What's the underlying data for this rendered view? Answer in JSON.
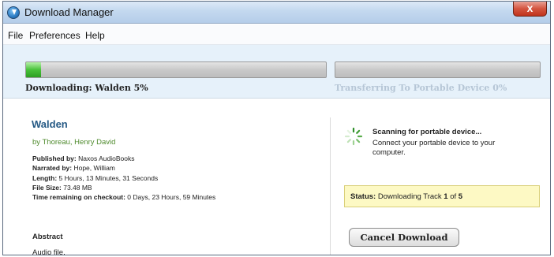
{
  "window": {
    "title": "Download Manager",
    "close_glyph": "x"
  },
  "menu": [
    "File",
    "Preferences",
    "Help"
  ],
  "progress": {
    "download_label": "Downloading: Walden  5%",
    "download_fraction": 0.05,
    "transfer_label": "Transferring To Portable Device 0%",
    "transfer_fraction": 0.0,
    "fill_color": "#49c23a"
  },
  "book": {
    "title": "Walden",
    "author": "by Thoreau, Henry David",
    "published_by_label": "Published by:",
    "published_by": "Naxos AudioBooks",
    "narrated_by_label": "Narrated by:",
    "narrated_by": "Hope, William",
    "length_label": "Length:",
    "length": "5 Hours, 13 Minutes, 31 Seconds",
    "file_size_label": "File Size:",
    "file_size": "73.48 MB",
    "time_remaining_label": "Time remaining on checkout:",
    "time_remaining": "0 Days, 23 Hours, 59 Minutes",
    "abstract_title": "Abstract",
    "abstract_text": "Audio file."
  },
  "device": {
    "scan_title": "Scanning for portable device...",
    "scan_body": "Connect your portable device to your computer.",
    "spinner_icon": "spinner-icon"
  },
  "status": {
    "label": "Status:",
    "text_prefix": "Downloading Track",
    "current_track": "1",
    "of_text": "of",
    "total_tracks": "5"
  },
  "cancel_label": "Cancel Download"
}
